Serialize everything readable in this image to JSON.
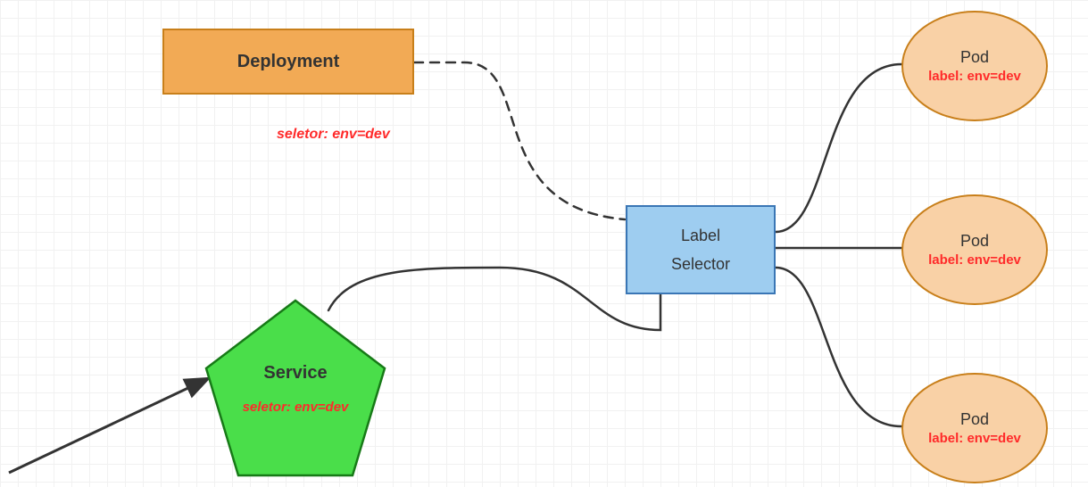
{
  "deployment": {
    "label": "Deployment",
    "selector_annotation": "seletor:  env=dev"
  },
  "label_selector": {
    "line1": "Label",
    "line2": "Selector"
  },
  "service": {
    "label": "Service",
    "selector_annotation": "seletor:  env=dev"
  },
  "pods": [
    {
      "title": "Pod",
      "label": "label: env=dev"
    },
    {
      "title": "Pod",
      "label": "label: env=dev"
    },
    {
      "title": "Pod",
      "label": "label: env=dev"
    }
  ],
  "colors": {
    "deployment_fill": "#f2aa55",
    "selector_fill": "#9ecdf0",
    "pod_fill": "#f9d1a6",
    "service_fill": "#4ade4a",
    "accent_text": "#ff2a2a"
  }
}
